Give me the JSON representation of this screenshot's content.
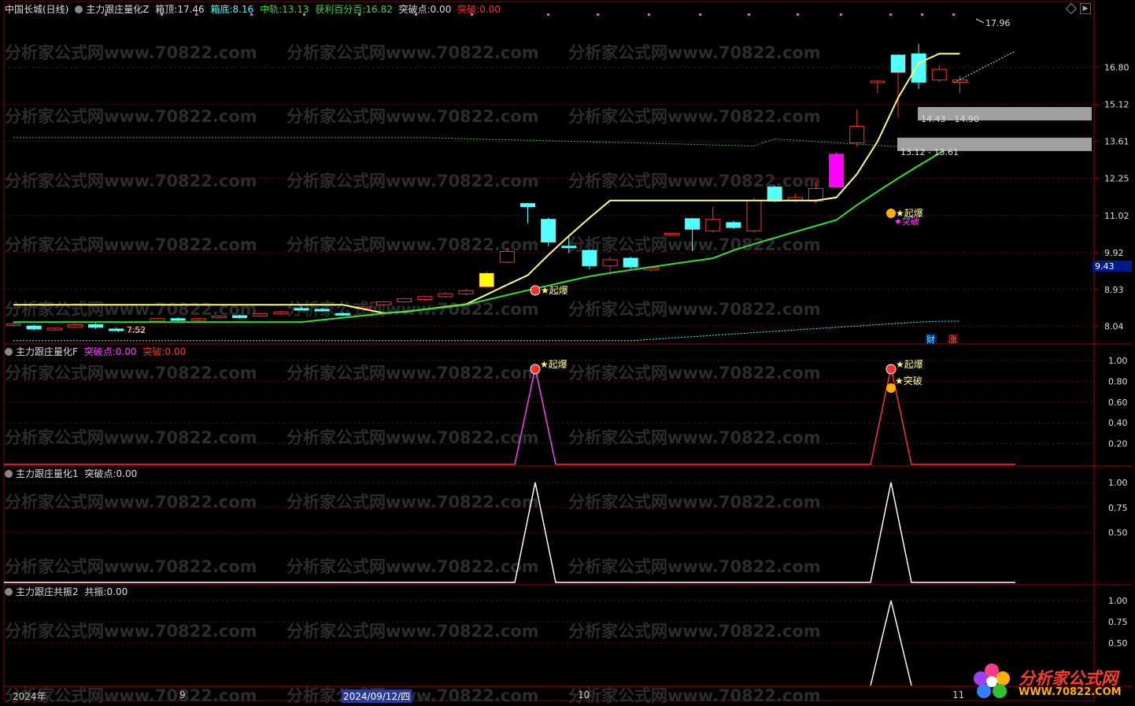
{
  "main": {
    "stock": "中国长城(日线)",
    "indicator": "主力跟庄量化Z",
    "box_top_label": "箱顶:",
    "box_top": "17.46",
    "box_bottom_label": "箱底:",
    "box_bottom": "8.16",
    "mid_label": "中轨:",
    "mid": "13.13",
    "profit_label": "获利百分百:",
    "profit": "16.82",
    "break_pt_label": "突破点:",
    "break_pt": "0.00",
    "break_label": "突破:",
    "break_val": "0.00",
    "y_ticks": [
      "16.80",
      "15.12",
      "13.61",
      "12.25",
      "11.02",
      "9.92",
      "8.93",
      "8.04"
    ],
    "current_price": "9.43",
    "high_label": "17.96",
    "low_label": "7.52",
    "zone1": "14.43 - 14.90",
    "zone2": "13.12 - 13.61",
    "qibao": "起爆",
    "tupo": "突破",
    "cai": "财",
    "zhang": "涨"
  },
  "pane_f": {
    "name": "主力跟庄量化F",
    "break_pt_label": "突破点:",
    "break_pt": "0.00",
    "break_label": "突破:",
    "break_val": "0.00",
    "y_ticks": [
      "1.00",
      "0.80",
      "0.60",
      "0.40",
      "0.20"
    ]
  },
  "pane_1": {
    "name": "主力跟庄量化1",
    "break_pt_label": "突破点:",
    "break_pt": "0.00",
    "y_ticks": [
      "1.00",
      "0.75",
      "0.50"
    ]
  },
  "pane_2": {
    "name": "主力跟庄共振2",
    "label": "共振:",
    "value": "0.00",
    "y_ticks": [
      "1.00",
      "0.75",
      "0.50"
    ]
  },
  "dates": {
    "year": "2024年",
    "m9": "9",
    "cursor": "2024/09/12/四",
    "m10": "10",
    "m11": "11"
  },
  "watermark": "分析家公式网www.70822.com",
  "logo": {
    "line1": "分析家公式网",
    "line2": "WWW.70822.COM"
  },
  "colors": {
    "up": "#ff3030",
    "down": "#54ffff",
    "yellow": "#ffff80",
    "green": "#30e030",
    "magenta": "#ff40ff"
  },
  "chart_data": {
    "type": "candlestick",
    "y_axis_ticks": [
      16.8,
      15.12,
      13.61,
      12.25,
      11.02,
      9.92,
      8.93,
      8.04
    ],
    "candles": [
      {
        "o": 8.08,
        "c": 8.1,
        "h": 8.14,
        "l": 8.04
      },
      {
        "o": 8.05,
        "c": 7.98,
        "h": 8.08,
        "l": 7.95
      },
      {
        "o": 7.96,
        "c": 8.0,
        "h": 8.02,
        "l": 7.94
      },
      {
        "o": 8.02,
        "c": 8.08,
        "h": 8.1,
        "l": 8.0
      },
      {
        "o": 8.08,
        "c": 8.02,
        "h": 8.12,
        "l": 7.98
      },
      {
        "o": 7.98,
        "c": 7.96,
        "h": 8.02,
        "l": 7.94
      },
      {
        "o": 7.92,
        "c": 7.98,
        "h": 8.0,
        "l": 7.88
      },
      {
        "o": 8.16,
        "c": 8.22,
        "h": 8.24,
        "l": 8.14
      },
      {
        "o": 8.22,
        "c": 8.18,
        "h": 8.25,
        "l": 8.16
      },
      {
        "o": 8.18,
        "c": 8.22,
        "h": 8.24,
        "l": 8.16
      },
      {
        "o": 8.24,
        "c": 8.28,
        "h": 8.3,
        "l": 8.22
      },
      {
        "o": 8.29,
        "c": 8.24,
        "h": 8.31,
        "l": 8.22
      },
      {
        "o": 8.28,
        "c": 8.34,
        "h": 8.36,
        "l": 8.26
      },
      {
        "o": 8.33,
        "c": 8.38,
        "h": 8.4,
        "l": 8.3
      },
      {
        "o": 8.46,
        "c": 8.45,
        "h": 8.52,
        "l": 8.42
      },
      {
        "o": 8.44,
        "c": 8.43,
        "h": 8.48,
        "l": 8.4
      },
      {
        "o": 8.34,
        "c": 8.33,
        "h": 8.38,
        "l": 8.28
      },
      {
        "o": 8.46,
        "c": 8.5,
        "h": 8.52,
        "l": 8.44
      },
      {
        "o": 8.55,
        "c": 8.62,
        "h": 8.64,
        "l": 8.52
      },
      {
        "o": 8.62,
        "c": 8.7,
        "h": 8.72,
        "l": 8.6
      },
      {
        "o": 8.68,
        "c": 8.75,
        "h": 8.78,
        "l": 8.64
      },
      {
        "o": 8.75,
        "c": 8.82,
        "h": 8.86,
        "l": 8.72
      },
      {
        "o": 8.82,
        "c": 8.9,
        "h": 8.94,
        "l": 8.78
      },
      {
        "o": 9.0,
        "c": 9.35,
        "h": 9.4,
        "l": 8.98
      },
      {
        "o": 9.65,
        "c": 9.95,
        "h": 10.05,
        "l": 9.62
      },
      {
        "o": 11.4,
        "c": 11.3,
        "h": 11.42,
        "l": 10.78
      },
      {
        "o": 10.9,
        "c": 10.22,
        "h": 10.95,
        "l": 10.1
      },
      {
        "o": 10.1,
        "c": 10.08,
        "h": 10.4,
        "l": 9.9
      },
      {
        "o": 9.98,
        "c": 9.55,
        "h": 10.0,
        "l": 9.45
      },
      {
        "o": 9.55,
        "c": 9.72,
        "h": 9.8,
        "l": 9.3
      },
      {
        "o": 9.76,
        "c": 9.52,
        "h": 9.8,
        "l": 9.46
      },
      {
        "o": 9.44,
        "c": 9.5,
        "h": 9.54,
        "l": 9.4
      },
      {
        "o": 10.45,
        "c": 10.48,
        "h": 10.5,
        "l": 10.42
      },
      {
        "o": 10.92,
        "c": 10.6,
        "h": 10.95,
        "l": 9.96
      },
      {
        "o": 10.55,
        "c": 10.9,
        "h": 11.3,
        "l": 10.5
      },
      {
        "o": 10.8,
        "c": 10.65,
        "h": 10.86,
        "l": 10.6
      },
      {
        "o": 10.55,
        "c": 11.5,
        "h": 11.58,
        "l": 10.5
      },
      {
        "o": 11.95,
        "c": 11.48,
        "h": 12.0,
        "l": 11.45
      },
      {
        "o": 11.52,
        "c": 11.6,
        "h": 11.72,
        "l": 11.45
      },
      {
        "o": 11.48,
        "c": 11.9,
        "h": 12.15,
        "l": 11.42
      },
      {
        "o": 11.95,
        "c": 13.12,
        "h": 13.2,
        "l": 11.9
      },
      {
        "o": 13.55,
        "c": 14.2,
        "h": 14.9,
        "l": 13.4
      },
      {
        "o": 16.1,
        "c": 16.15,
        "h": 16.2,
        "l": 15.6
      },
      {
        "o": 16.55,
        "c": 17.4,
        "h": 17.46,
        "l": 14.55
      },
      {
        "o": 17.45,
        "c": 16.1,
        "h": 17.96,
        "l": 15.8
      },
      {
        "o": 16.2,
        "c": 16.7,
        "h": 16.9,
        "l": 16.1
      },
      {
        "o": 16.1,
        "c": 16.2,
        "h": 16.4,
        "l": 15.6
      }
    ]
  }
}
